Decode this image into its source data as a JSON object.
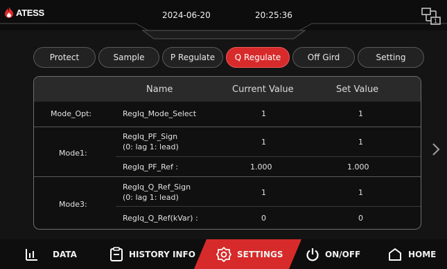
{
  "header": {
    "brand": "ATESS",
    "date": "2024-06-20",
    "time": "20:25:36"
  },
  "tabs": [
    {
      "label": "Protect",
      "active": false
    },
    {
      "label": "Sample",
      "active": false
    },
    {
      "label": "P Regulate",
      "active": false
    },
    {
      "label": "Q Regulate",
      "active": true
    },
    {
      "label": "Off Gird",
      "active": false
    },
    {
      "label": "Setting",
      "active": false
    }
  ],
  "table": {
    "columns": [
      "Name",
      "Current Value",
      "Set Value"
    ],
    "groups": [
      {
        "label": "Mode_Opt:",
        "rows": [
          {
            "name": [
              "RegIq_Mode_Select"
            ],
            "current": "1",
            "set": "1"
          }
        ]
      },
      {
        "label": "Mode1:",
        "rows": [
          {
            "name": [
              "RegIq_PF_Sign",
              "(0: lag 1: lead)"
            ],
            "current": "1",
            "set": "1"
          },
          {
            "name": [
              "RegIq_PF_Ref :"
            ],
            "current": "1.000",
            "set": "1.000"
          }
        ]
      },
      {
        "label": "Mode3:",
        "rows": [
          {
            "name": [
              "RegIq_Q_Ref_Sign",
              "(0: lag 1: lead)"
            ],
            "current": "1",
            "set": "1"
          },
          {
            "name": [
              "RegIq_Q_Ref(kVar) :"
            ],
            "current": "0",
            "set": "0"
          }
        ]
      }
    ]
  },
  "nav": [
    {
      "label": "DATA",
      "icon": "bar-chart-icon",
      "active": false
    },
    {
      "label": "HISTORY INFO",
      "icon": "clipboard-icon",
      "active": false
    },
    {
      "label": "SETTINGS",
      "icon": "gear-icon",
      "active": true
    },
    {
      "label": "ON/OFF",
      "icon": "power-icon",
      "active": false
    },
    {
      "label": "HOME",
      "icon": "home-icon",
      "active": false
    }
  ],
  "colors": {
    "accent": "#d72a2a",
    "background": "#141414",
    "panel_border": "#6e6e6e"
  }
}
